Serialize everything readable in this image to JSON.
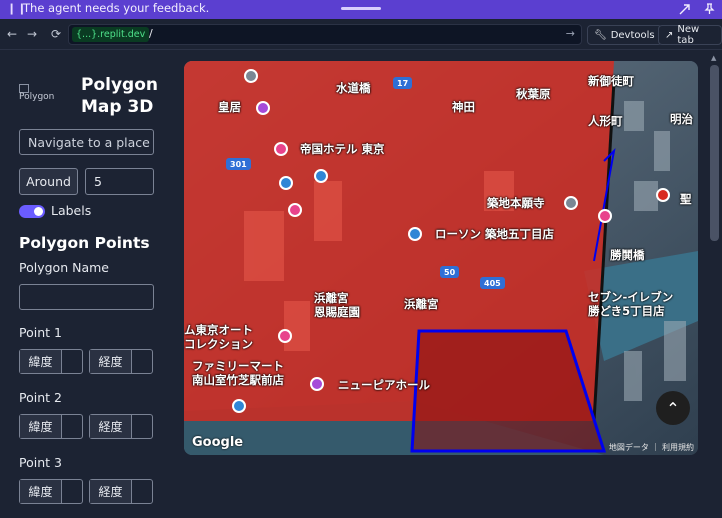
{
  "banner": {
    "pause_icon": "pause-icon",
    "message": "The agent needs your feedback."
  },
  "urlbar": {
    "domain": "{...}.replit.dev",
    "path": "/",
    "devtools_label": "Devtools",
    "newtab_label": "New tab"
  },
  "panel": {
    "logo_alt": "Polygon",
    "title": "Polygon Map 3D",
    "search": {
      "placeholder": "Navigate to a place"
    },
    "around": {
      "label": "Around",
      "value": "5"
    },
    "labels_toggle": {
      "label": "Labels",
      "on": true
    },
    "section_title": "Polygon Points",
    "polygon_name_label": "Polygon Name",
    "polygon_name_value": "",
    "points": [
      {
        "label": "Point 1",
        "lat_label": "緯度",
        "lng_label": "経度"
      },
      {
        "label": "Point 2",
        "lat_label": "緯度",
        "lng_label": "経度"
      },
      {
        "label": "Point 3",
        "lat_label": "緯度",
        "lng_label": "経度"
      }
    ]
  },
  "map": {
    "labels": {
      "kokyo": "皇居",
      "suidobashi": "水道橋",
      "kanda": "神田",
      "akihabara": "秋葉原",
      "shin_ochanomizu": "新御徒町",
      "ningyocho": "人形町",
      "meiji": "明治",
      "hotel": "帝国ホテル 東京",
      "tsukiji": "築地本願寺",
      "lawson": "ローソン 築地五丁目店",
      "kachidoki": "勝鬨橋",
      "hamarikyu": "浜離宮\n恩賜庭園",
      "hama_station": "浜離宮",
      "seven": "セブン-イレブン\n勝どき5丁目店",
      "auto": "ム東京オート\nコレクション",
      "familymart": "ファミリーマート\n南山室竹芝駅前店",
      "newpier": "ニューピアホール",
      "sei": "聖"
    },
    "route_badges": [
      "301",
      "17",
      "50",
      "405"
    ],
    "google_logo": "Google",
    "attribution": "地図データ ｜ 利用規約",
    "fab_icon": "chevron-up-icon"
  },
  "colors": {
    "accent": "#6a5cff",
    "banner": "#5b3fd0",
    "overlay_red": "#d82a1f",
    "polygon_blue": "#0000ee"
  }
}
